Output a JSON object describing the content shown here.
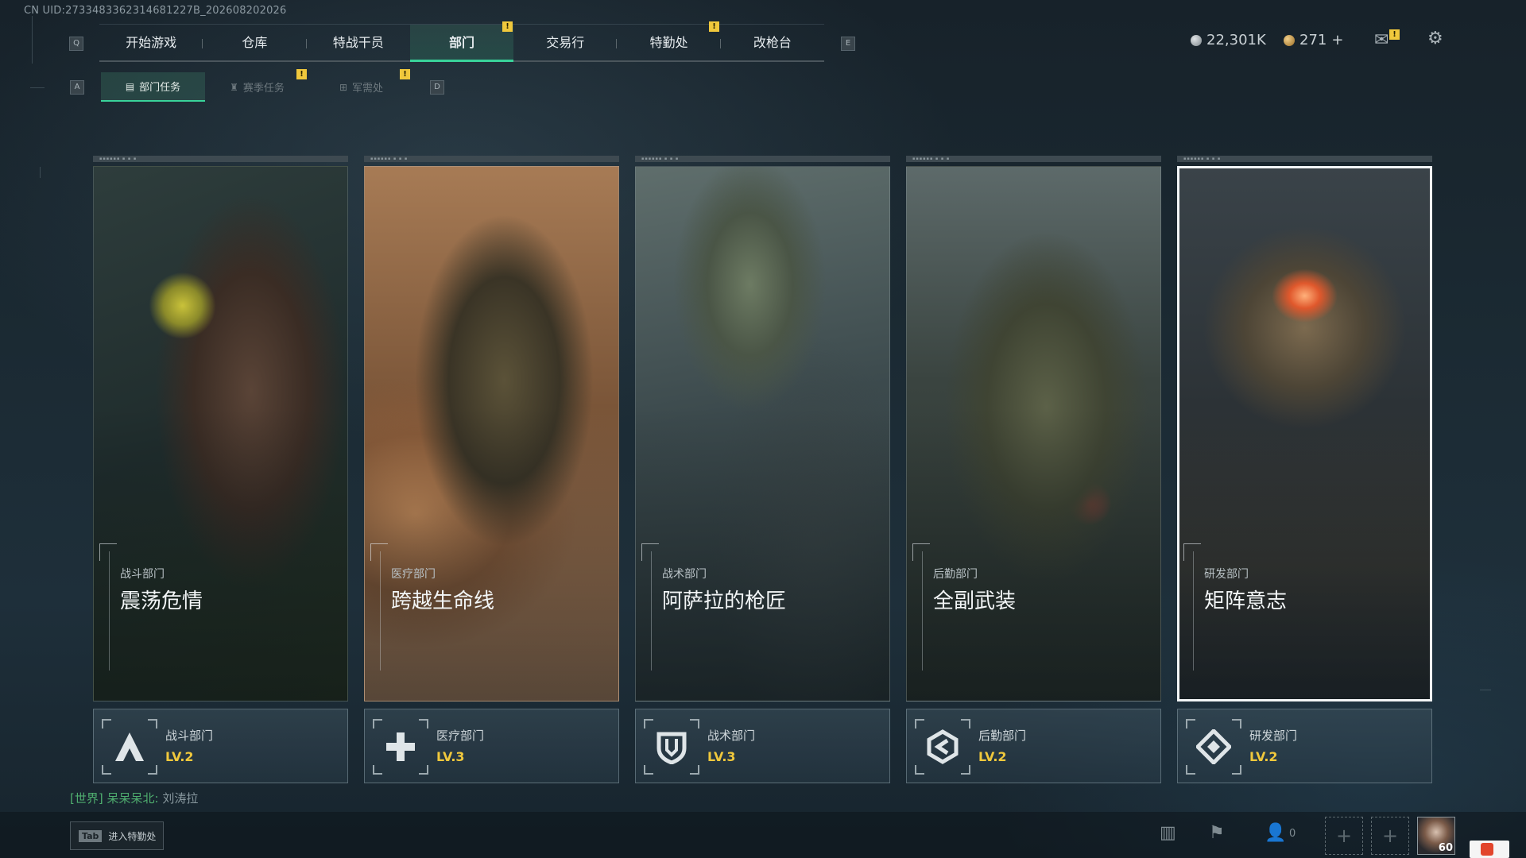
{
  "uid_text": "CN UID:2733483362314681227B_202608202026",
  "nav": {
    "left_key": "Q",
    "right_key": "E",
    "tabs": [
      {
        "label": "开始游戏"
      },
      {
        "label": "仓库"
      },
      {
        "label": "特战干员"
      },
      {
        "label": "部门",
        "active": true
      },
      {
        "label": "交易行"
      },
      {
        "label": "特勤处"
      },
      {
        "label": "改枪台"
      }
    ],
    "badge": "!"
  },
  "subnav": {
    "left_key": "A",
    "right_key": "D",
    "tabs": [
      {
        "label": "部门任务",
        "active": true
      },
      {
        "label": "赛季任务"
      },
      {
        "label": "军需处"
      }
    ]
  },
  "currency": {
    "silver": "22,301K",
    "gold": "271",
    "gold_add": "+"
  },
  "cards": [
    {
      "sub": "战斗部门",
      "title": "震荡危情"
    },
    {
      "sub": "医疗部门",
      "title": "跨越生命线"
    },
    {
      "sub": "战术部门",
      "title": "阿萨拉的枪匠"
    },
    {
      "sub": "后勤部门",
      "title": "全副武装"
    },
    {
      "sub": "研发部门",
      "title": "矩阵意志"
    }
  ],
  "departments": [
    {
      "name": "战斗部门",
      "level": "LV.2",
      "icon": "combat-a-icon"
    },
    {
      "name": "医疗部门",
      "level": "LV.3",
      "icon": "medical-cross-icon"
    },
    {
      "name": "战术部门",
      "level": "LV.3",
      "icon": "tactical-shield-icon"
    },
    {
      "name": "后勤部门",
      "level": "LV.2",
      "icon": "logistics-hex-icon"
    },
    {
      "name": "研发部门",
      "level": "LV.2",
      "icon": "research-diamond-icon"
    }
  ],
  "chat": {
    "channel": "[世界]",
    "sender": "呆呆呆北:",
    "message": "刘涛拉"
  },
  "bottom": {
    "tab_key": "Tab",
    "tab_label": "进入特勤处",
    "friends_count": "0",
    "avatar_level": "60"
  },
  "colors": {
    "accent_green": "#39d39a",
    "level_gold": "#f0c83c",
    "badge_yellow": "#f0c83c"
  }
}
